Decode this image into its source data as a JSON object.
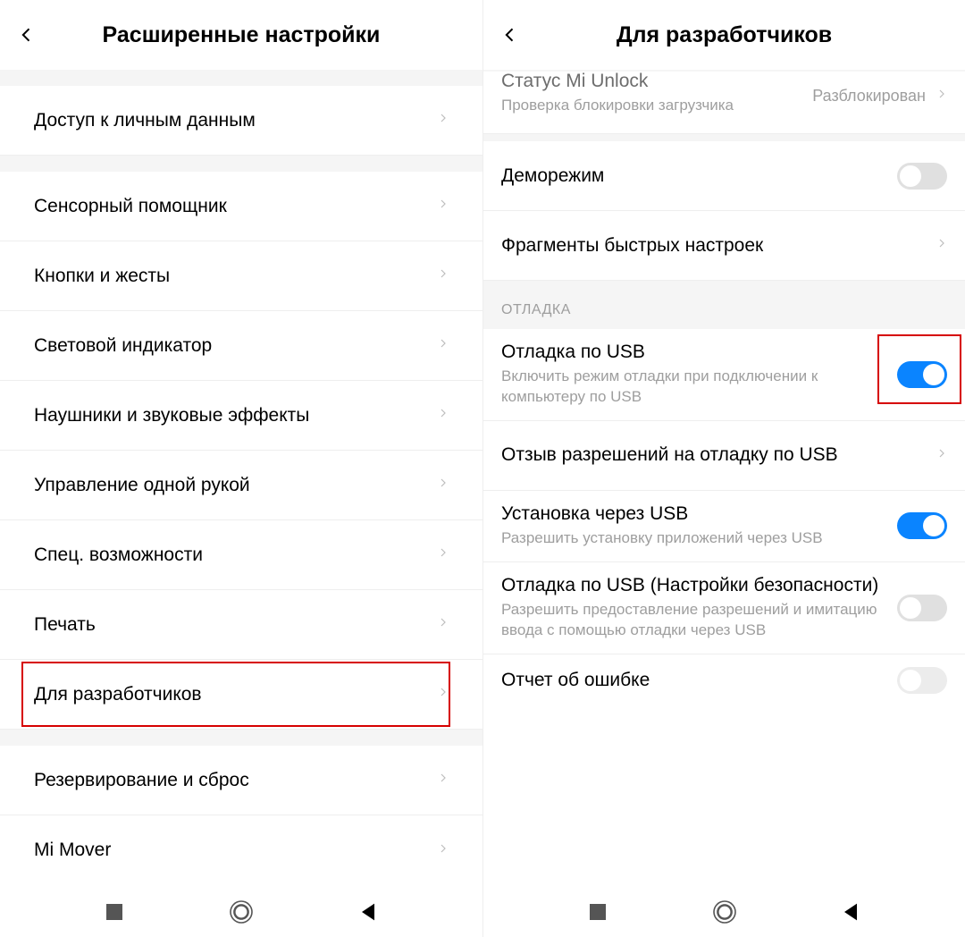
{
  "left": {
    "title": "Расширенные настройки",
    "items": [
      {
        "label": "Доступ к личным данным"
      },
      {
        "label": "Сенсорный помощник"
      },
      {
        "label": "Кнопки и жесты"
      },
      {
        "label": "Световой индикатор"
      },
      {
        "label": "Наушники и звуковые эффекты"
      },
      {
        "label": "Управление одной рукой"
      },
      {
        "label": "Спец. возможности"
      },
      {
        "label": "Печать"
      },
      {
        "label": "Для разработчиков"
      },
      {
        "label": "Резервирование и сброс"
      },
      {
        "label": "Mi Mover"
      }
    ]
  },
  "right": {
    "title": "Для разработчиков",
    "unlock": {
      "label": "Статус Mi Unlock",
      "sub": "Проверка блокировки загрузчика",
      "value": "Разблокирован"
    },
    "demo": {
      "label": "Деморежим"
    },
    "qsfrag": {
      "label": "Фрагменты быстрых настроек"
    },
    "section_debug": "ОТЛАДКА",
    "usb_debug": {
      "label": "Отладка по USB",
      "sub": "Включить режим отладки при подключении к компьютеру по USB"
    },
    "revoke": {
      "label": "Отзыв разрешений на отладку по USB"
    },
    "install_usb": {
      "label": "Установка через USB",
      "sub": "Разрешить установку приложений через USB"
    },
    "usb_sec": {
      "label": "Отладка по USB (Настройки безопасности)",
      "sub": "Разрешить предоставление разрешений и имитацию ввода с помощью отладки через USB"
    },
    "bugreport": {
      "label": "Отчет об ошибке"
    }
  }
}
